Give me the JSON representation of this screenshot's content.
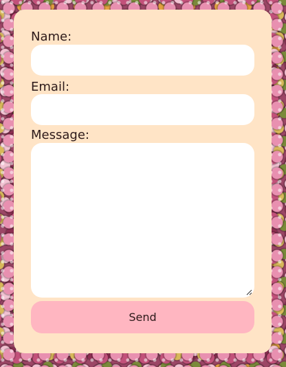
{
  "form": {
    "name_label": "Name:",
    "name_value": "",
    "email_label": "Email:",
    "email_value": "",
    "message_label": "Message:",
    "message_value": "",
    "send_label": "Send"
  },
  "colors": {
    "card_background": "#ffe4c6",
    "field_background": "#ffffff",
    "button_background": "#ffb6c1",
    "text": "#2c1a1a"
  },
  "background": {
    "style": "candy-sprinkles"
  }
}
